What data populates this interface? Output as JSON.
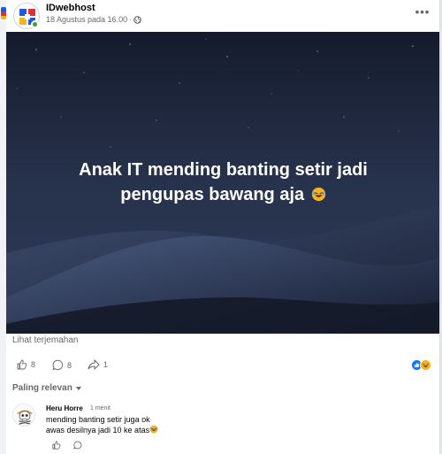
{
  "post": {
    "page_name": "IDwebhost",
    "timestamp": "18 Agustus pada 16.00",
    "separator": "·",
    "more_label": "•••",
    "caption_line1": "Anak IT mending banting setir jadi",
    "caption_line2": "pengupas bawang aja",
    "see_translation": "Lihat terjemahan"
  },
  "actions": {
    "like_count": "8",
    "comment_count": "8",
    "share_count": "1"
  },
  "comments": {
    "sort_label": "Paling relevan",
    "items": [
      {
        "author": "Heru Horre",
        "time": "1 menit",
        "line1": "mending banting setir juga ok",
        "line2": "awas desilnya jadi 10 ke atas"
      }
    ]
  },
  "colors": {
    "accent": "#1877f2",
    "secondary_text": "#65676b",
    "online": "#31a24c",
    "haha": "#f7b125"
  },
  "icons": [
    "idwebhost-logo",
    "globe-icon",
    "more-icon",
    "like-icon",
    "comment-icon",
    "share-icon",
    "like-reaction-icon",
    "haha-reaction-icon",
    "laughing-emoji-icon"
  ]
}
